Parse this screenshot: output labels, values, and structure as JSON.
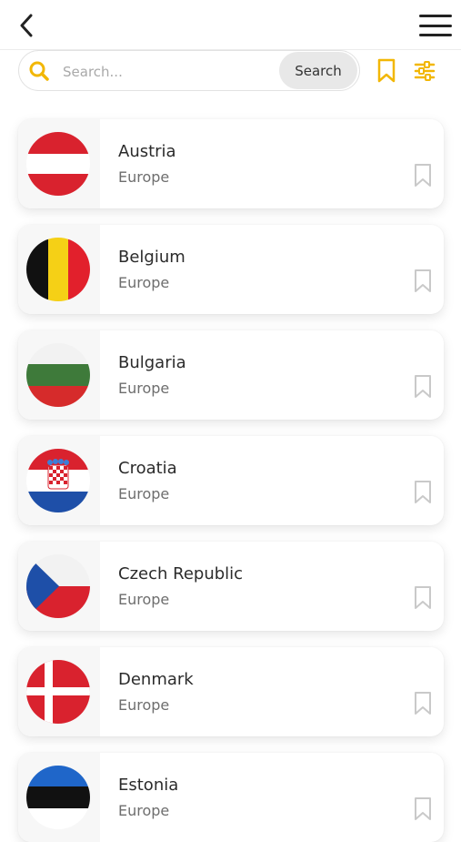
{
  "header": {
    "back_icon": "chevron-left-icon",
    "menu_icon": "hamburger-menu-icon"
  },
  "search": {
    "placeholder": "Search...",
    "button_label": "Search",
    "accent_color": "#F2B705"
  },
  "countries": [
    {
      "name": "Austria",
      "region": "Europe",
      "flag": "austria"
    },
    {
      "name": "Belgium",
      "region": "Europe",
      "flag": "belgium"
    },
    {
      "name": "Bulgaria",
      "region": "Europe",
      "flag": "bulgaria"
    },
    {
      "name": "Croatia",
      "region": "Europe",
      "flag": "croatia"
    },
    {
      "name": "Czech Republic",
      "region": "Europe",
      "flag": "czech-republic"
    },
    {
      "name": "Denmark",
      "region": "Europe",
      "flag": "denmark"
    },
    {
      "name": "Estonia",
      "region": "Europe",
      "flag": "estonia"
    }
  ]
}
